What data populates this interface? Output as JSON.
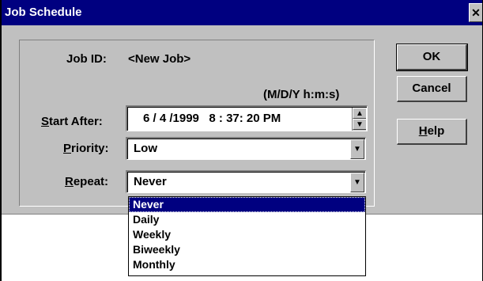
{
  "window": {
    "title": "Job Schedule",
    "close_glyph": "✕"
  },
  "job": {
    "label": "Job ID:",
    "value": "<New Job>"
  },
  "format_hint": "(M/D/Y h:m:s)",
  "start_after": {
    "label_mnemonic": "S",
    "label_rest": "tart After:",
    "value": "6 / 4 /1999   8 : 37: 20 PM"
  },
  "priority": {
    "label_mnemonic": "P",
    "label_rest": "riority:",
    "value": "Low"
  },
  "repeat": {
    "label_mnemonic": "R",
    "label_rest": "epeat:",
    "value": "Never",
    "options": [
      "Never",
      "Daily",
      "Weekly",
      "Biweekly",
      "Monthly"
    ],
    "selected_index": 0
  },
  "buttons": {
    "ok": "OK",
    "cancel": "Cancel",
    "help_mnemonic": "H",
    "help_rest": "elp"
  },
  "icons": {
    "close": "close-icon",
    "spin_up": "spin-up-arrow-icon",
    "spin_down": "spin-down-arrow-icon",
    "dropdown": "dropdown-arrow-icon"
  },
  "colors": {
    "titlebar": "#000080",
    "face": "#c0c0c0",
    "selection": "#000080"
  }
}
